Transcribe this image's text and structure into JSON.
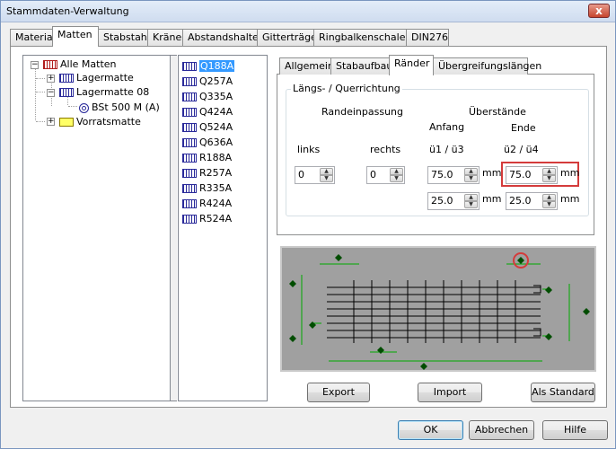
{
  "window": {
    "title": "Stammdaten-Verwaltung",
    "close_label": "x"
  },
  "top_tabs": [
    {
      "label": "Material"
    },
    {
      "label": "Matten"
    },
    {
      "label": "Stabstahl"
    },
    {
      "label": "Kräne"
    },
    {
      "label": "Abstandshalter"
    },
    {
      "label": "Gitterträger"
    },
    {
      "label": "Ringbalkenschalen"
    },
    {
      "label": "DIN276"
    }
  ],
  "tree": {
    "root": "Alle Matten",
    "lagermatte": "Lagermatte",
    "lagermatte08": "Lagermatte 08",
    "steel": "BSt 500 M (A)",
    "vorratsmatte": "Vorratsmatte"
  },
  "mat_list": [
    "Q188A",
    "Q257A",
    "Q335A",
    "Q424A",
    "Q524A",
    "Q636A",
    "R188A",
    "R257A",
    "R335A",
    "R424A",
    "R524A"
  ],
  "inner_tabs": [
    {
      "label": "Allgemein"
    },
    {
      "label": "Stabaufbau"
    },
    {
      "label": "Ränder"
    },
    {
      "label": "Übergreifungslängen"
    }
  ],
  "group": {
    "title": "Längs- / Querrichtung",
    "randeinpassung": "Randeinpassung",
    "ueberstaende": "Überstände",
    "anfang": "Anfang",
    "ende": "Ende",
    "links": "links",
    "rechts": "rechts",
    "u1u3": "ü1 / ü3",
    "u2u4": "ü2 / ü4",
    "unit": "mm"
  },
  "fields": {
    "links_value": "0",
    "rechts_value": "0",
    "u1_value": "75.0",
    "u2_value": "75.0",
    "u3_value": "25.0",
    "u4_value": "25.0"
  },
  "buttons": {
    "export": "Export",
    "import": "Import",
    "als_standard": "Als Standard",
    "ok": "OK",
    "abbrechen": "Abbrechen",
    "hilfe": "Hilfe"
  },
  "colors": {
    "mesh_bar": "#000000",
    "dimension": "#00aa00",
    "highlight": "#d43b3b",
    "preview_bg": "#a0a0a0"
  }
}
